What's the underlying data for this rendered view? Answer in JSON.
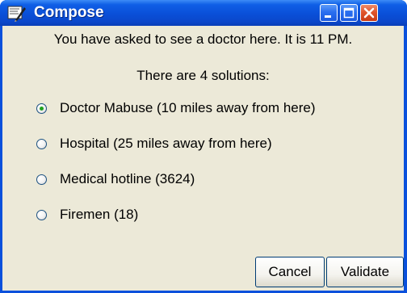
{
  "window": {
    "title": "Compose",
    "icon": "compose-app-icon",
    "controls": {
      "minimize": "minimize-icon",
      "maximize": "maximize-icon",
      "close": "close-icon"
    }
  },
  "message": {
    "line1": "You have asked to see a doctor here. It is 11 PM.",
    "line2": "There are 4 solutions:"
  },
  "options": [
    {
      "label": "Doctor Mabuse (10 miles away from here)",
      "selected": true
    },
    {
      "label": "Hospital (25 miles away from here)",
      "selected": false
    },
    {
      "label": "Medical hotline (3624)",
      "selected": false
    },
    {
      "label": "Firemen (18)",
      "selected": false
    }
  ],
  "buttons": {
    "cancel": "Cancel",
    "validate": "Validate"
  }
}
